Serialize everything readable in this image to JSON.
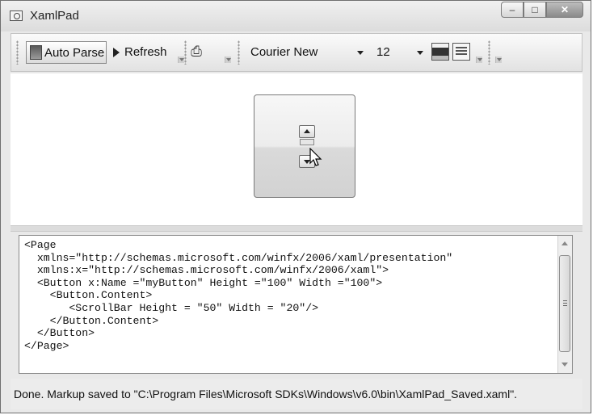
{
  "window": {
    "title": "XamlPad",
    "icon": "xamlpad-app-icon"
  },
  "caption_buttons": {
    "minimize": "minimize-icon",
    "maximize": "maximize-icon",
    "close": "close-icon"
  },
  "toolbar": {
    "auto_parse_label": "Auto Parse",
    "refresh_label": "Refresh",
    "font_family": "Courier New",
    "font_size": "12"
  },
  "preview": {
    "button_name": "myButton",
    "scrollbar": "vertical-scrollbar"
  },
  "editor": {
    "lines": [
      "<Page",
      "  xmlns=\"http://schemas.microsoft.com/winfx/2006/xaml/presentation\"",
      "  xmlns:x=\"http://schemas.microsoft.com/winfx/2006/xaml\">",
      "  <Button x:Name =\"myButton\" Height =\"100\" Width =\"100\">",
      "    <Button.Content>",
      "       <ScrollBar Height = \"50\" Width = \"20\"/>",
      "    </Button.Content>",
      "  </Button>",
      "</Page>"
    ]
  },
  "status": {
    "text": "Done. Markup saved to \"C:\\Program Files\\Microsoft SDKs\\Windows\\v6.0\\bin\\XamlPad_Saved.xaml\"."
  }
}
